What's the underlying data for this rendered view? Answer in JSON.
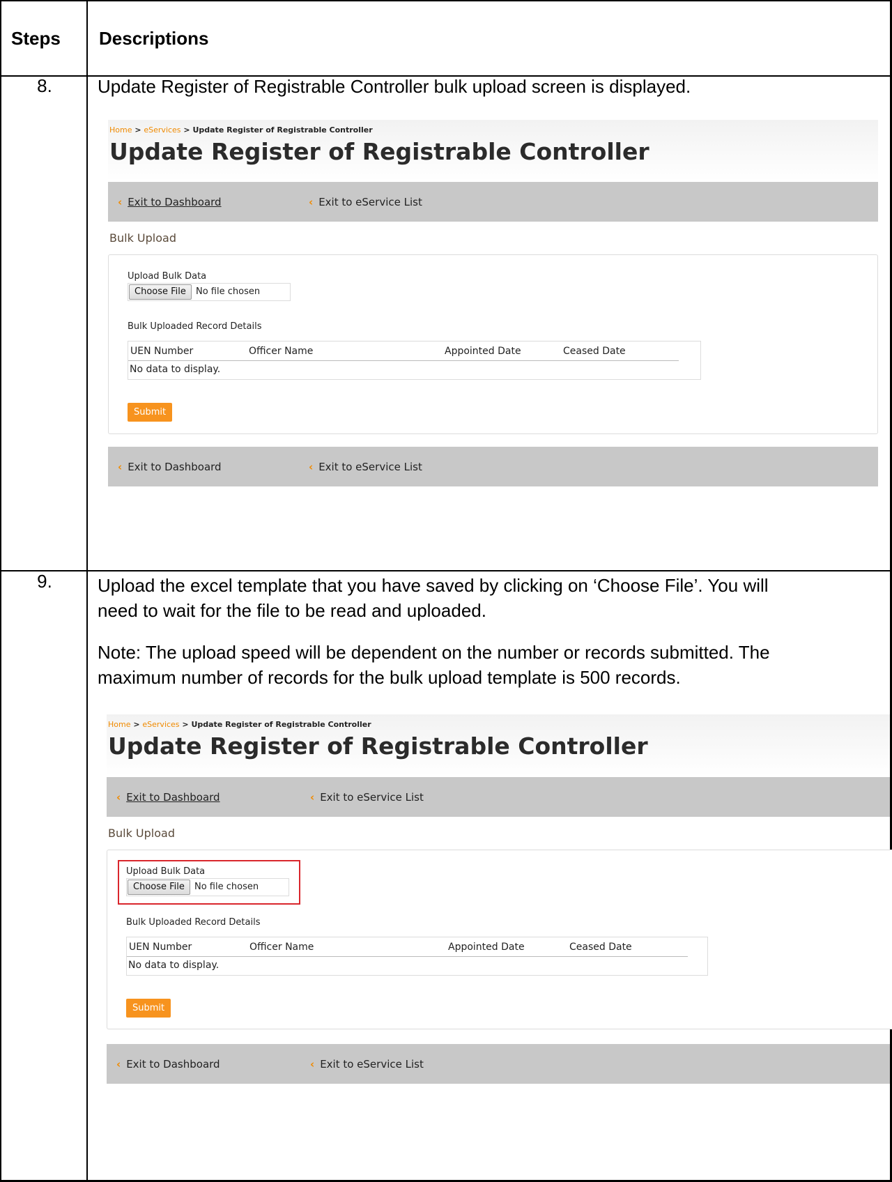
{
  "table": {
    "col_steps": "Steps",
    "col_descriptions": "Descriptions"
  },
  "rows": [
    {
      "step": "8.",
      "description_lines": [
        "Update Register of Registrable Controller bulk upload screen is displayed."
      ]
    },
    {
      "step": "9.",
      "description_lines": [
        "Upload the excel template that you have saved by clicking on ‘Choose File’.  You will",
        "need to wait for the file to be read and uploaded."
      ],
      "note_lines": [
        "Note: The upload speed will be dependent on the number or records submitted. The",
        "maximum number of records for the bulk upload template is 500 records."
      ]
    }
  ],
  "screen": {
    "breadcrumb_home": "Home",
    "breadcrumb_sep": ">",
    "breadcrumb_eservices": "eServices",
    "breadcrumb_current": "Update Register of Registrable Controller",
    "title": "Update Register of Registrable Controller",
    "nav_chevron": "‹",
    "exit_dashboard": "Exit to Dashboard",
    "exit_eservice_list": "Exit to eService List",
    "section": "Bulk Upload",
    "upload_label": "Upload Bulk Data",
    "choose_file": "Choose File",
    "no_file": "No file chosen",
    "details_label": "Bulk Uploaded Record Details",
    "columns": [
      "UEN Number",
      "Officer Name",
      "Appointed Date",
      "Ceased Date"
    ],
    "no_data": "No data to display.",
    "submit": "Submit"
  },
  "colors": {
    "accent": "#f7931e",
    "link": "#f08a00",
    "nav_bg": "#c8c8c8",
    "highlight": "#d9262c"
  }
}
